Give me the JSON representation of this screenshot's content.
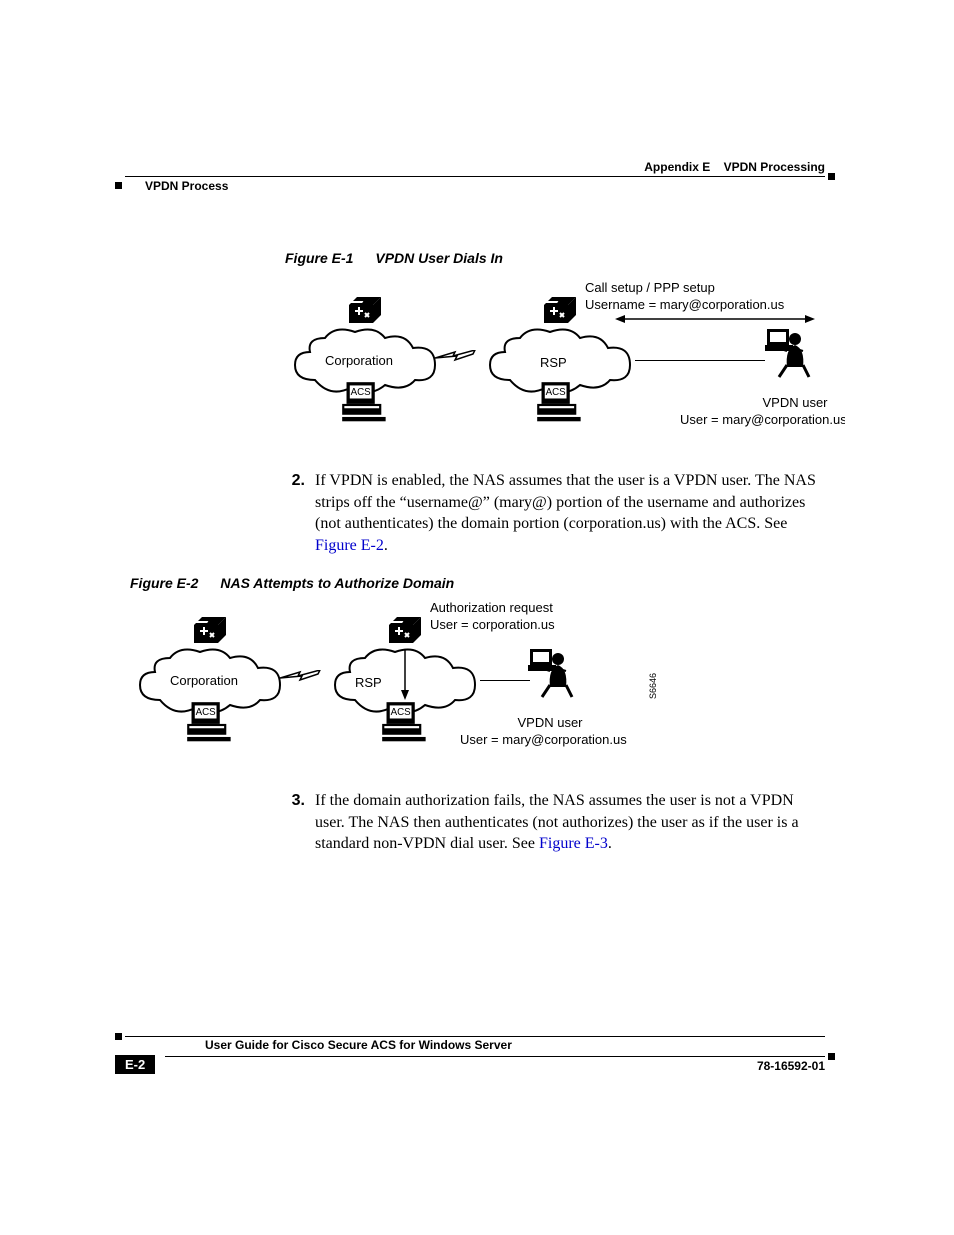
{
  "header": {
    "appendix": "Appendix E",
    "appendix_title": "VPDN Processing",
    "section": "VPDN Process"
  },
  "fig1": {
    "label": "Figure E-1",
    "title": "VPDN User Dials In",
    "call_setup": "Call setup / PPP setup",
    "username": "Username = mary@corporation.us",
    "corp": "Corporation",
    "rsp": "RSP",
    "acs": "ACS",
    "vpdn_user": "VPDN user",
    "user_line": "User = mary@corporation.us"
  },
  "step2": {
    "num": "2.",
    "text_a": "If VPDN is enabled, the NAS assumes that the user is a VPDN user. The NAS strips off the “username@” (mary@) portion of the username and authorizes (not authenticates) the domain portion (corporation.us) with the ACS. See ",
    "link": "Figure E-2",
    "text_b": "."
  },
  "fig2": {
    "label": "Figure E-2",
    "title": "NAS Attempts to Authorize Domain",
    "auth_req": "Authorization request",
    "user_line_top": "User = corporation.us",
    "corp": "Corporation",
    "rsp": "RSP",
    "acs": "ACS",
    "vpdn_user": "VPDN user",
    "user_line_bottom": "User = mary@corporation.us",
    "ref_id": "S6646"
  },
  "step3": {
    "num": "3.",
    "text_a": "If the domain authorization fails, the NAS assumes the user is not a VPDN user. The NAS then authenticates (not authorizes) the user as if the user is a standard non-VPDN dial user. See ",
    "link": "Figure E-3",
    "text_b": "."
  },
  "footer": {
    "guide": "User Guide for Cisco Secure ACS for Windows Server",
    "page": "E-2",
    "doc": "78-16592-01"
  }
}
